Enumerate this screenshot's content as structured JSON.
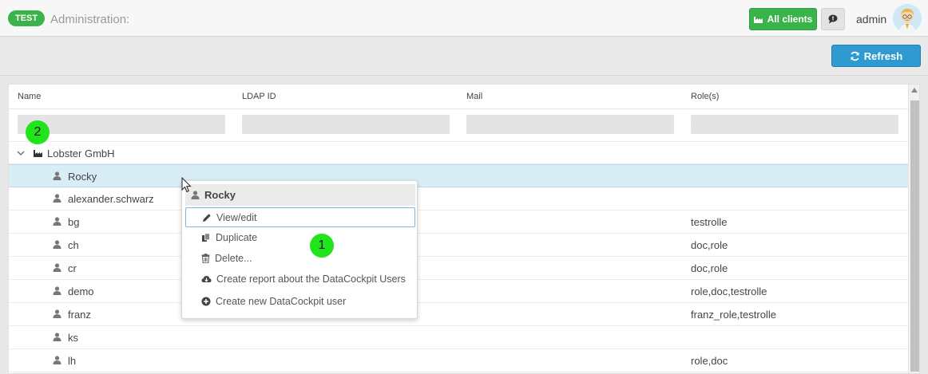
{
  "header": {
    "env_badge": "TEST",
    "title": "Administration:",
    "all_clients_label": "All clients",
    "user_name": "admin",
    "brand_color": "#3ab34a"
  },
  "toolbar": {
    "refresh_label": "Refresh",
    "refresh_color": "#2e9ad0"
  },
  "table": {
    "columns": [
      "Name",
      "LDAP ID",
      "Mail",
      "Role(s)"
    ],
    "group": {
      "label": "Lobster GmbH",
      "icon": "factory-icon",
      "expanded": true
    },
    "rows": [
      {
        "name": "Rocky",
        "ldap": "",
        "mail": "",
        "roles": "",
        "selected": true
      },
      {
        "name": "alexander.schwarz",
        "ldap": "",
        "mail": "",
        "roles": ""
      },
      {
        "name": "bg",
        "ldap": "",
        "mail": "",
        "roles": "testrolle"
      },
      {
        "name": "ch",
        "ldap": "",
        "mail": "",
        "roles": "doc,role"
      },
      {
        "name": "cr",
        "ldap": "",
        "mail": "",
        "roles": "doc,role"
      },
      {
        "name": "demo",
        "ldap": "",
        "mail": "",
        "roles": "role,doc,testrolle"
      },
      {
        "name": "franz",
        "ldap": "",
        "mail": "",
        "roles": "franz_role,testrolle"
      },
      {
        "name": "ks",
        "ldap": "",
        "mail": "",
        "roles": ""
      },
      {
        "name": "lh",
        "ldap": "",
        "mail": "",
        "roles": "role,doc"
      }
    ]
  },
  "context_menu": {
    "title": "Rocky",
    "items": [
      {
        "label": "View/edit",
        "icon": "pencil-icon"
      },
      {
        "label": "Duplicate",
        "icon": "copy-icon"
      },
      {
        "label": "Delete...",
        "icon": "trash-icon"
      },
      {
        "label": "Create report about the DataCockpit Users",
        "icon": "cloud-download-icon"
      },
      {
        "label": "Create new DataCockpit user",
        "icon": "plus-circle-icon"
      }
    ]
  },
  "markers": [
    "1",
    "2"
  ]
}
